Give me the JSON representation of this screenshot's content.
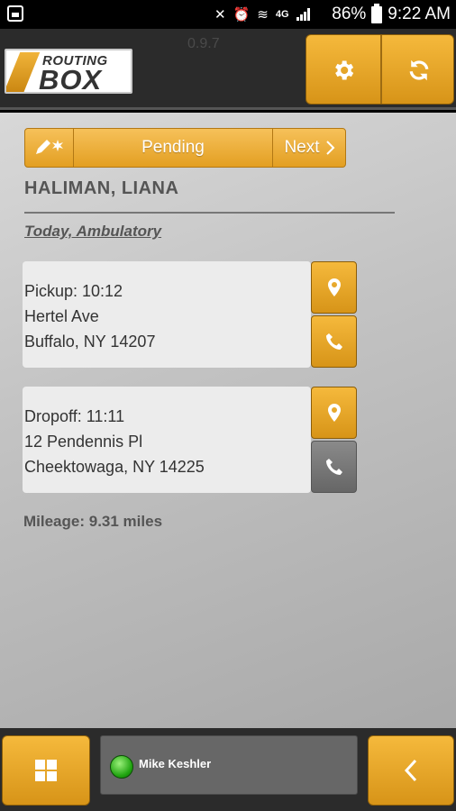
{
  "status_bar": {
    "battery": "86%",
    "time": "9:22 AM",
    "network": "4G"
  },
  "header": {
    "logo_top": "ROUTING",
    "logo_bottom": "BOX",
    "version": "0.9.7",
    "settings_icon": "gear-icon",
    "refresh_icon": "refresh-icon"
  },
  "trip": {
    "edit_icon": "pencil-sparkle-icon",
    "status": "Pending",
    "next_label": "Next",
    "passenger_name": "HALIMAN, LIANA",
    "description": "Today, Ambulatory",
    "pickup": {
      "line1": "Pickup: 10:12",
      "line2": "Hertel Ave",
      "line3": "Buffalo, NY 14207"
    },
    "dropoff": {
      "line1": "Dropoff: 11:11",
      "line2": "12 Pendennis Pl",
      "line3": "Cheektowaga, NY 14225"
    },
    "mileage": "Mileage: 9.31 miles"
  },
  "footer": {
    "driver_name": "Mike Keshler",
    "driver_status_color": "#22aa11",
    "menu_icon": "grid-icon",
    "back_icon": "chevron-left-icon"
  },
  "colors": {
    "accent": "#e8a524",
    "header_bg": "#2b2b2b"
  }
}
